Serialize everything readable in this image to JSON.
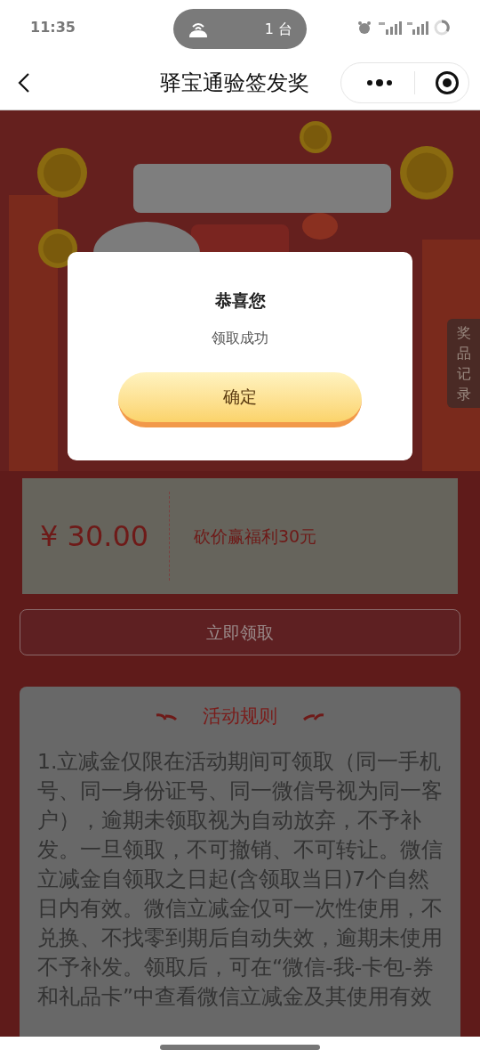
{
  "status_bar": {
    "time": "11:35",
    "hotspot": "1 台"
  },
  "nav_bar": {
    "title": "驿宝通验签发奖"
  },
  "side_tab": {
    "label": "奖品记录"
  },
  "coupon": {
    "amount": "¥ 30.00",
    "description": "砍价赢福利30元"
  },
  "claim_button": {
    "label": "立即领取"
  },
  "rules": {
    "title": "活动规则",
    "text": "1.立减金仅限在活动期间可领取（同一手机号、同一身份证号、同一微信号视为同一客户），逾期未领取视为自动放弃，不予补发。一旦领取，不可撤销、不可转让。微信立减金自领取之日起(含领取当日)7个自然日内有效。微信立减金仅可一次性使用，不兑换、不找零到期后自动失效，逾期未使用不予补发。领取后，可在“微信-我-卡包-券和礼品卡”中查看微信立减金及其使用有效"
  },
  "dialog": {
    "title": "恭喜您",
    "message": "领取成功",
    "button": "确定"
  }
}
